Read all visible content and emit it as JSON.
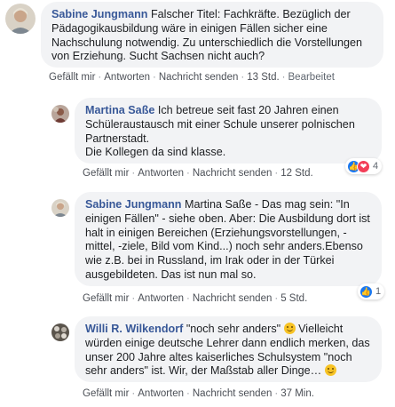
{
  "comments": [
    {
      "author": "Sabine Jungmann",
      "text": "Falscher Titel: Fachkräfte. Bezüglich der Pädagogikausbildung wäre in einigen Fällen sicher eine Nachschulung notwendig. Zu unterschiedlich die Vorstellungen von Erziehung. Sucht Sachsen nicht auch?",
      "actions": {
        "like": "Gefällt mir",
        "reply": "Antworten",
        "send": "Nachricht senden",
        "time": "13 Std.",
        "edited": "Bearbeitet"
      }
    },
    {
      "author": "Martina Saße",
      "text_lines": [
        "Ich betreue seit fast 20 Jahren einen Schüleraustausch mit einer Schule unserer polnischen Partnerstadt.",
        "Die Kollegen da sind klasse."
      ],
      "actions": {
        "like": "Gefällt mir",
        "reply": "Antworten",
        "send": "Nachricht senden",
        "time": "12 Std."
      },
      "reactions": {
        "count": "4",
        "icons": [
          "like-icon",
          "love-icon"
        ]
      }
    },
    {
      "author": "Sabine Jungmann",
      "text": "Martina Saße - Das mag sein: \"In einigen Fällen\" - siehe oben. Aber: Die Ausbildung dort ist halt in einigen Bereichen (Erziehungsvorstellungen, -mittel, -ziele, Bild vom Kind...) noch sehr anders.Ebenso wie z.B. bei in Russland, im Irak oder in der Türkei ausgebildeten. Das ist nun mal so.",
      "actions": {
        "like": "Gefällt mir",
        "reply": "Antworten",
        "send": "Nachricht senden",
        "time": "5 Std."
      },
      "reactions": {
        "count": "1",
        "icons": [
          "like-icon"
        ]
      }
    },
    {
      "author": "Willi R. Wilkendorf",
      "text_a": "\"noch sehr anders\"",
      "text_b": "Vielleicht würden einige deutsche Lehrer dann endlich merken, das unser 200 Jahre altes kaiserliches Schulsystem \"noch sehr anders\" ist. Wir, der Maßstab aller Dinge…",
      "actions": {
        "like": "Gefällt mir",
        "reply": "Antworten",
        "send": "Nachricht senden",
        "time": "37 Min."
      },
      "emojis": [
        "smiley-emoji",
        "smiley-emoji"
      ]
    }
  ],
  "colors": {
    "author": "#385898",
    "bubble": "#f2f3f5",
    "like": "#1877f2",
    "love": "#f33e58"
  }
}
